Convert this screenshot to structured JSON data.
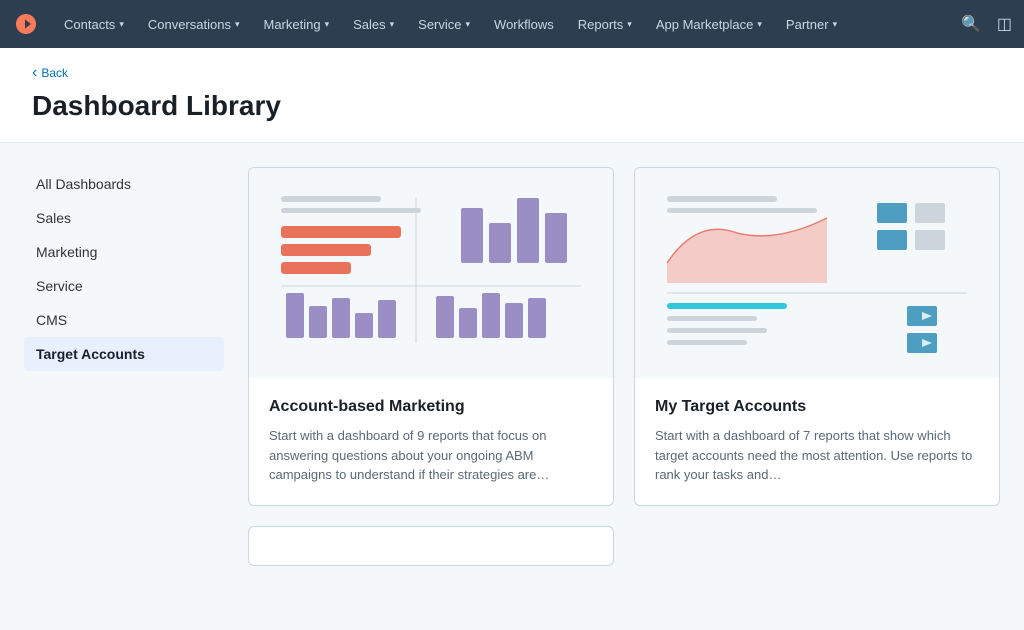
{
  "nav": {
    "items": [
      {
        "label": "Contacts",
        "has_dropdown": true
      },
      {
        "label": "Conversations",
        "has_dropdown": true
      },
      {
        "label": "Marketing",
        "has_dropdown": true
      },
      {
        "label": "Sales",
        "has_dropdown": true
      },
      {
        "label": "Service",
        "has_dropdown": true
      },
      {
        "label": "Workflows",
        "has_dropdown": false
      },
      {
        "label": "Reports",
        "has_dropdown": true
      },
      {
        "label": "App Marketplace",
        "has_dropdown": true
      },
      {
        "label": "Partner",
        "has_dropdown": true
      }
    ]
  },
  "header": {
    "back_label": "Back",
    "title": "Dashboard Library"
  },
  "sidebar": {
    "items": [
      {
        "label": "All Dashboards",
        "active": false
      },
      {
        "label": "Sales",
        "active": false
      },
      {
        "label": "Marketing",
        "active": false
      },
      {
        "label": "Service",
        "active": false
      },
      {
        "label": "CMS",
        "active": false
      },
      {
        "label": "Target Accounts",
        "active": true
      }
    ]
  },
  "cards": [
    {
      "title": "Account-based Marketing",
      "description": "Start with a dashboard of 9 reports that focus on answering questions about your ongoing ABM campaigns to understand if their strategies are…"
    },
    {
      "title": "My Target Accounts",
      "description": "Start with a dashboard of 7 reports that show which target accounts need the most attention. Use reports to rank your tasks and…"
    }
  ]
}
